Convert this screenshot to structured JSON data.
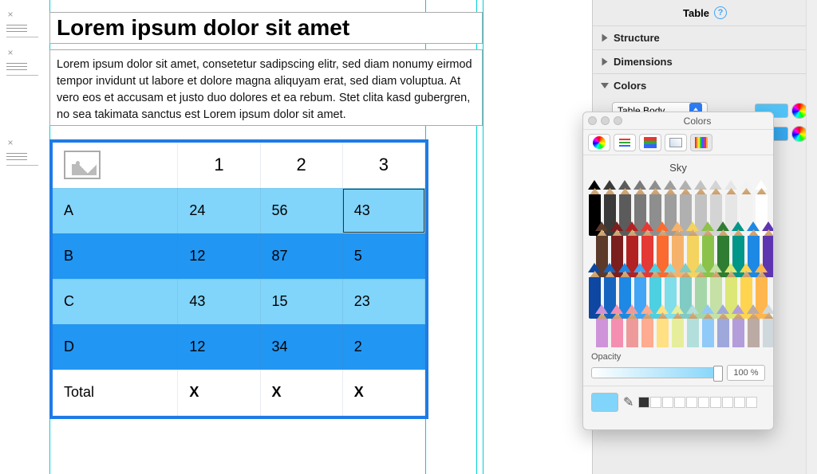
{
  "canvas": {
    "title": "Lorem ipsum dolor sit amet",
    "paragraph": "Lorem ipsum dolor sit amet, consetetur sadipscing elitr, sed diam nonumy eirmod tempor invidunt ut labore et dolore magna aliquyam erat, sed diam voluptua. At vero eos et accusam et justo duo dolores et ea rebum. Stet clita kasd gubergren, no sea takimata sanctus est Lorem ipsum dolor sit amet."
  },
  "chart_data": {
    "type": "table",
    "columns": [
      "",
      "1",
      "2",
      "3"
    ],
    "rows": [
      {
        "label": "A",
        "values": [
          "24",
          "56",
          "43"
        ],
        "shade": "light",
        "selected_col": 2
      },
      {
        "label": "B",
        "values": [
          "12",
          "87",
          "5"
        ],
        "shade": "dark"
      },
      {
        "label": "C",
        "values": [
          "43",
          "15",
          "23"
        ],
        "shade": "light"
      },
      {
        "label": "D",
        "values": [
          "12",
          "34",
          "2"
        ],
        "shade": "dark"
      }
    ],
    "footer": {
      "label": "Total",
      "values": [
        "X",
        "X",
        "X"
      ]
    }
  },
  "inspector": {
    "title": "Table",
    "sections": {
      "structure": "Structure",
      "dimensions": "Dimensions",
      "colors": "Colors"
    },
    "colors_target": "Table Body",
    "swatch_a": "#52c3f7",
    "swatch_b": "#36a9ef"
  },
  "color_picker": {
    "window_title": "Colors",
    "color_name": "Sky",
    "opacity_label": "Opacity",
    "opacity_value": "100 %",
    "selected_swatch": "#81d4fa",
    "pencil_rows": [
      [
        "#000000",
        "#3a3a3a",
        "#5b5b5b",
        "#7a7a7a",
        "#8e8e8e",
        "#9e9e9e",
        "#b0b0b0",
        "#c2c2c2",
        "#d4d4d4",
        "#e6e6e6",
        "#f2f2f2",
        "#ffffff"
      ],
      [
        "#5b3a29",
        "#7b1e1e",
        "#b22222",
        "#e53935",
        "#fb6a2e",
        "#f6b26b",
        "#f4d35e",
        "#8bc34a",
        "#2e7d32",
        "#009688",
        "#1e88e5",
        "#5e35b1"
      ],
      [
        "#0d47a1",
        "#1565c0",
        "#1e88e5",
        "#42a5f5",
        "#4dd0e1",
        "#80deea",
        "#80cbc4",
        "#a5d6a7",
        "#c5e1a5",
        "#dce775",
        "#ffd54f",
        "#ffb74d"
      ],
      [
        "#ce93d8",
        "#f48fb1",
        "#ef9a9a",
        "#ffab91",
        "#ffe082",
        "#e6ee9c",
        "#b2dfdb",
        "#90caf9",
        "#9fa8da",
        "#b39ddb",
        "#bcaaa4",
        "#cfd8dc"
      ]
    ]
  }
}
